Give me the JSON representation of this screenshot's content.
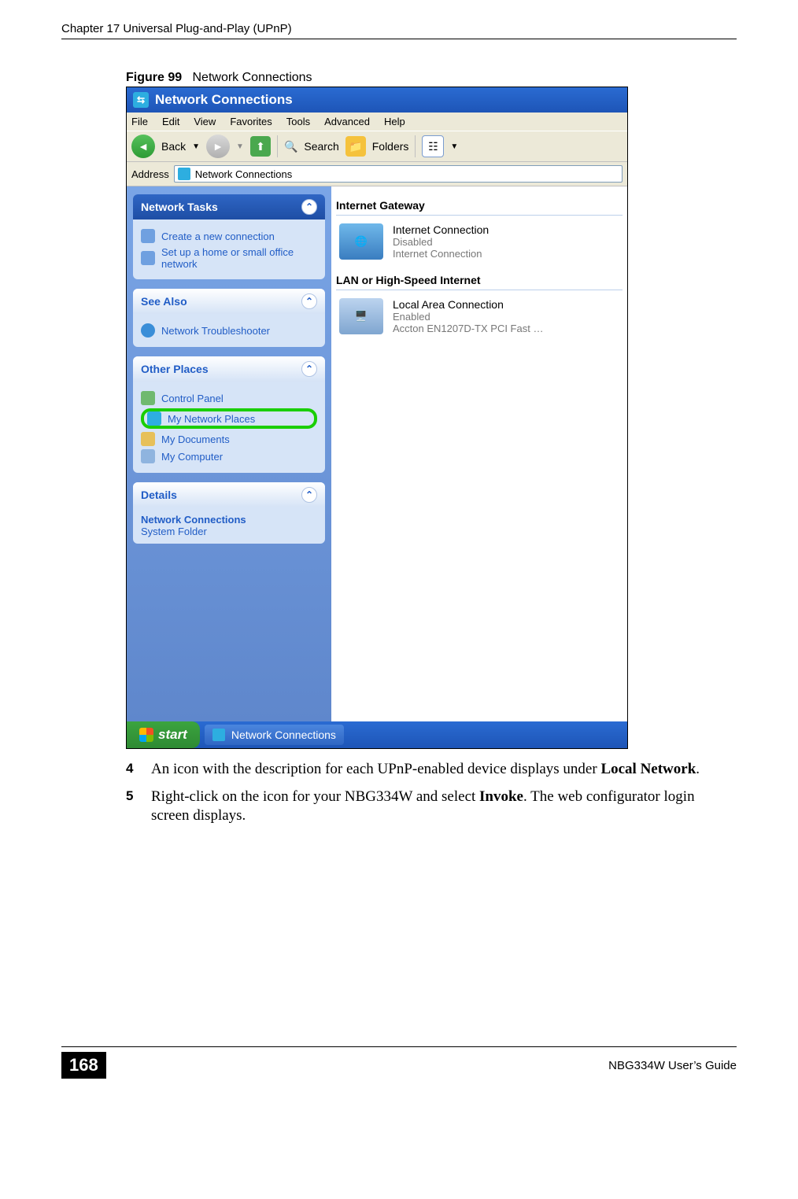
{
  "header": {
    "chapter": "Chapter 17 Universal Plug-and-Play (UPnP)"
  },
  "figure": {
    "label": "Figure 99",
    "title": "Network Connections"
  },
  "window": {
    "title": "Network Connections",
    "menu": [
      "File",
      "Edit",
      "View",
      "Favorites",
      "Tools",
      "Advanced",
      "Help"
    ],
    "toolbar": {
      "back": "Back",
      "search": "Search",
      "folders": "Folders"
    },
    "address": {
      "label": "Address",
      "value": "Network Connections"
    },
    "side": {
      "tasks": {
        "title": "Network Tasks",
        "items": [
          "Create a new connection",
          "Set up a home or small office network"
        ]
      },
      "seealso": {
        "title": "See Also",
        "items": [
          "Network Troubleshooter"
        ]
      },
      "other": {
        "title": "Other Places",
        "items": [
          "Control Panel",
          "My Network Places",
          "My Documents",
          "My Computer"
        ]
      },
      "details": {
        "title": "Details",
        "line1": "Network Connections",
        "line2": "System Folder"
      }
    },
    "main": {
      "group1": {
        "header": "Internet Gateway",
        "item": {
          "name": "Internet Connection",
          "status": "Disabled",
          "via": "Internet Connection"
        }
      },
      "group2": {
        "header": "LAN or High-Speed Internet",
        "item": {
          "name": "Local Area Connection",
          "status": "Enabled",
          "via": "Accton EN1207D-TX PCI Fast …"
        }
      }
    },
    "taskbar": {
      "start": "start",
      "item": "Network Connections"
    }
  },
  "steps": {
    "s4": {
      "num": "4",
      "textA": "An icon with the description for each UPnP-enabled device displays under ",
      "bold": "Local Network",
      "textB": "."
    },
    "s5": {
      "num": "5",
      "textA": "Right-click on the icon for your NBG334W and select ",
      "bold": "Invoke",
      "textB": ". The web configurator login screen displays."
    }
  },
  "footer": {
    "page": "168",
    "guide": "NBG334W User’s Guide"
  }
}
